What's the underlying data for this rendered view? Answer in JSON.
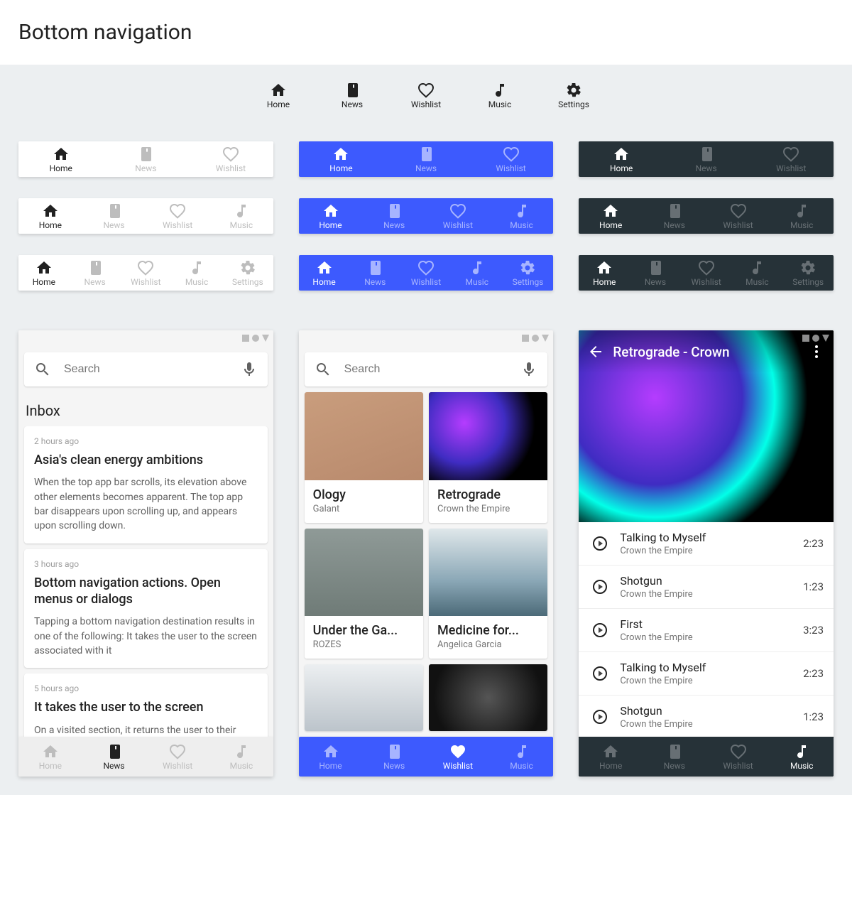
{
  "page_title": "Bottom navigation",
  "nav": {
    "home": "Home",
    "news": "News",
    "wishlist": "Wishlist",
    "music": "Music",
    "settings": "Settings"
  },
  "search_placeholder": "Search",
  "inbox": {
    "title": "Inbox",
    "items": [
      {
        "time": "2 hours ago",
        "title": "Asia's clean energy ambitions",
        "body": "When the top app bar scrolls, its elevation above other elements becomes apparent. The top app bar disappears upon scrolling up, and appears upon scrolling down."
      },
      {
        "time": "3 hours ago",
        "title": "Bottom navigation actions. Open menus or dialogs",
        "body": "Tapping a bottom navigation destination results in one of the following: It takes the user to the screen associated with it"
      },
      {
        "time": "5 hours ago",
        "title": "It takes the user to the screen",
        "body": "On a visited section, it returns the user to their previous scroll position there"
      }
    ]
  },
  "albums": [
    {
      "title": "Ology",
      "artist": "Galant"
    },
    {
      "title": "Retrograde",
      "artist": "Crown the Empire"
    },
    {
      "title": "Under the Ga...",
      "artist": "ROZES"
    },
    {
      "title": "Medicine for...",
      "artist": "Angelica Garcia"
    }
  ],
  "music": {
    "header": "Retrograde - Crown",
    "tracks": [
      {
        "title": "Talking to Myself",
        "artist": "Crown the Empire",
        "dur": "2:23"
      },
      {
        "title": "Shotgun",
        "artist": "Crown the Empire",
        "dur": "1:23"
      },
      {
        "title": "First",
        "artist": "Crown the Empire",
        "dur": "3:23"
      },
      {
        "title": "Talking to Myself",
        "artist": "Crown the Empire",
        "dur": "2:23"
      },
      {
        "title": "Shotgun",
        "artist": "Crown the Empire",
        "dur": "1:23"
      }
    ]
  }
}
